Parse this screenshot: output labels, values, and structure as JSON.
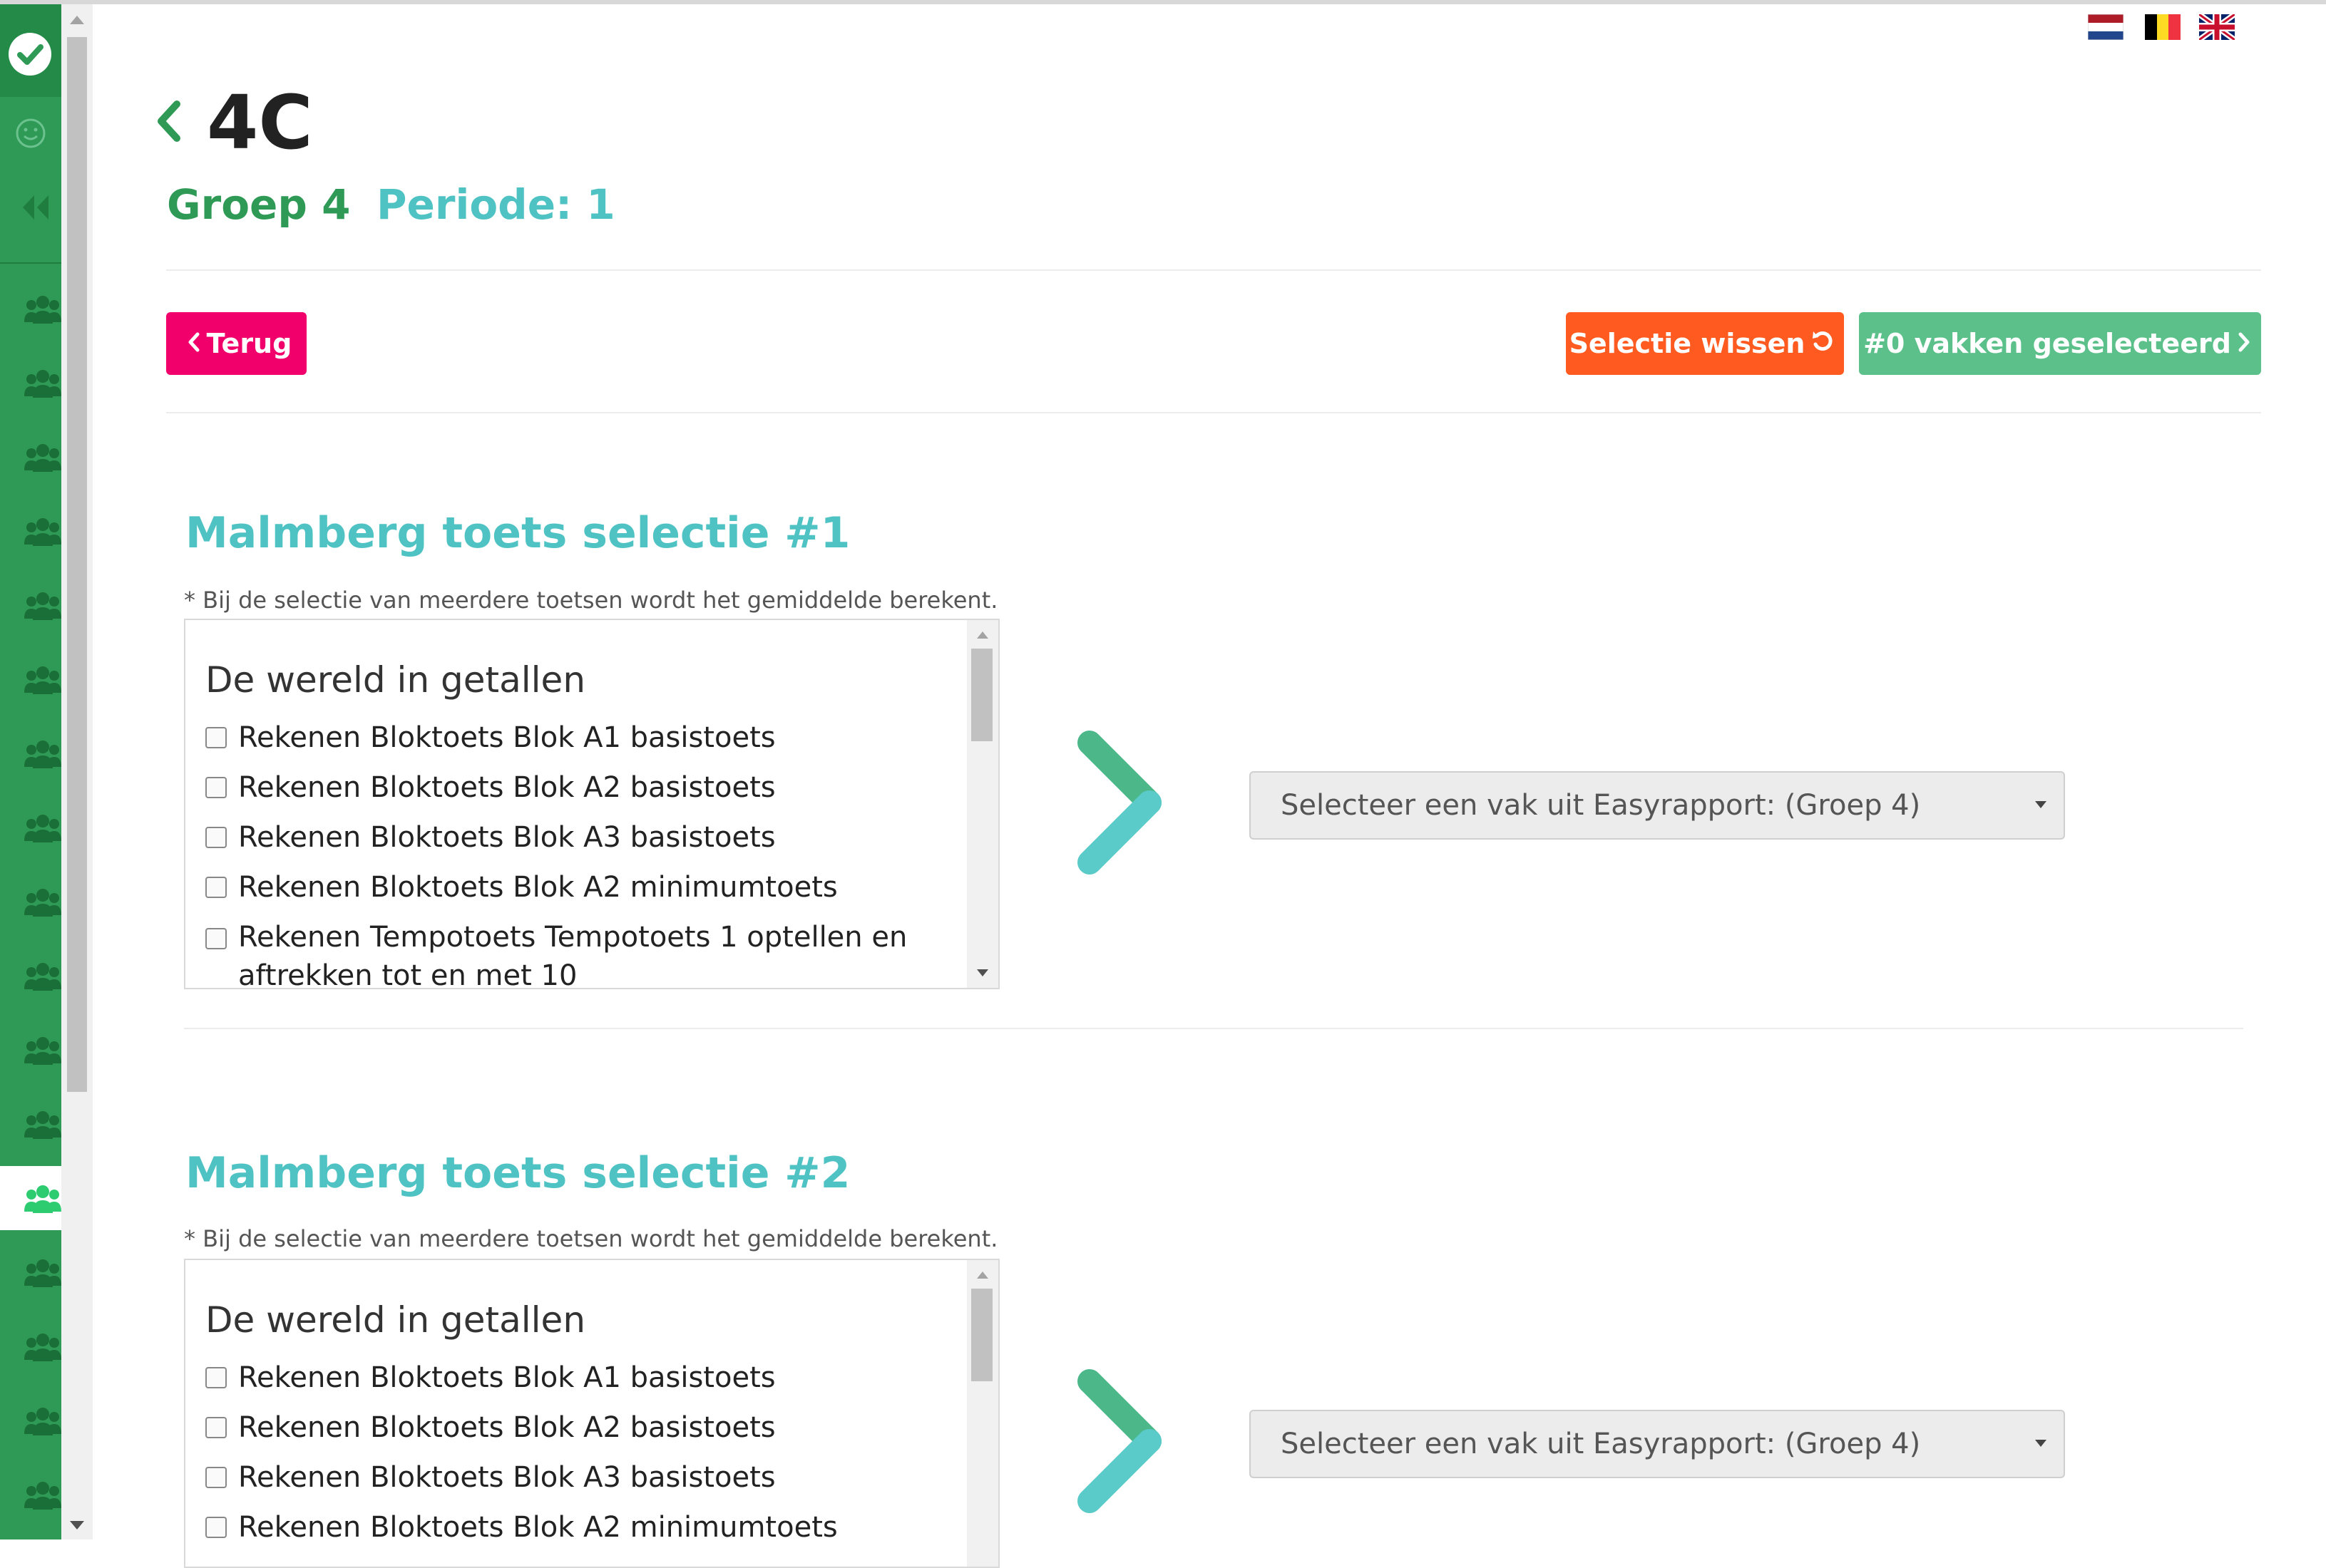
{
  "header": {
    "class_name": "4C",
    "group": "Groep 4",
    "period": "Periode: 1"
  },
  "toolbar": {
    "back_label": "Terug",
    "clear_label": "Selectie wissen",
    "selected_label": "#0 vakken geselecteerd"
  },
  "languages": [
    "nl",
    "be",
    "en"
  ],
  "sidebar": {
    "groups_count": 17,
    "active_index": 12
  },
  "sections": [
    {
      "title": "Malmberg toets selectie #1",
      "note": "* Bij de selectie van meerdere toetsen wordt het gemiddelde berekent.",
      "list_heading": "De wereld in getallen",
      "items": [
        "Rekenen Bloktoets Blok A1 basistoets",
        "Rekenen Bloktoets Blok A2 basistoets",
        "Rekenen Bloktoets Blok A3 basistoets",
        "Rekenen Bloktoets Blok A2 minimumtoets",
        "Rekenen Tempotoets Tempotoets 1 optellen en aftrekken tot en met 10"
      ],
      "select_placeholder": "Selecteer een vak uit Easyrapport: (Groep 4)"
    },
    {
      "title": "Malmberg toets selectie #2",
      "note": "* Bij de selectie van meerdere toetsen wordt het gemiddelde berekent.",
      "list_heading": "De wereld in getallen",
      "items": [
        "Rekenen Bloktoets Blok A1 basistoets",
        "Rekenen Bloktoets Blok A2 basistoets",
        "Rekenen Bloktoets Blok A3 basistoets",
        "Rekenen Bloktoets Blok A2 minimumtoets"
      ],
      "select_placeholder": "Selecteer een vak uit Easyrapport: (Groep 4)"
    }
  ],
  "colors": {
    "sidebar": "#2e9a55",
    "back_button": "#f1006c",
    "clear_button": "#ff5a1f",
    "selected_button": "#5bc08a",
    "section_title": "#4fc3c4",
    "group_text": "#2e9a55"
  }
}
